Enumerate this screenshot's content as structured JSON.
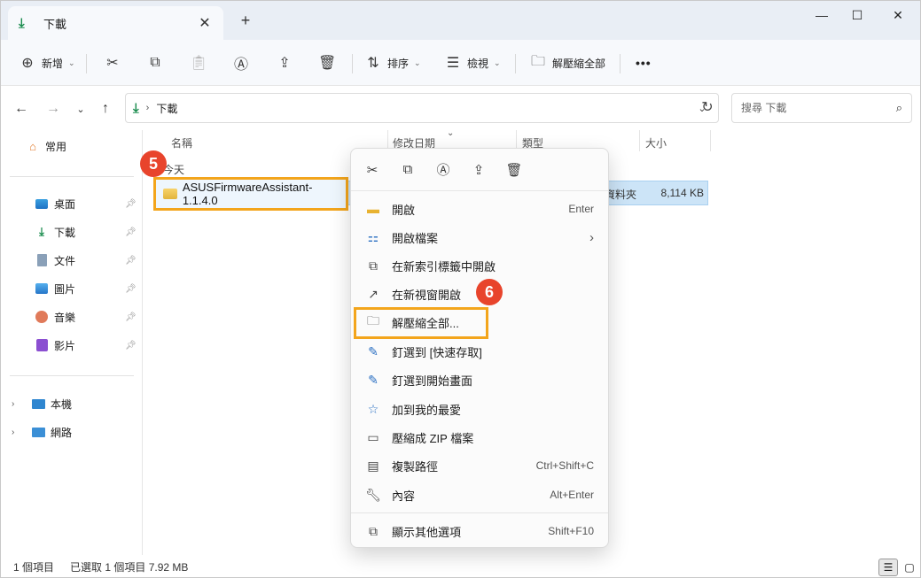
{
  "tab": {
    "title": "下載",
    "close": "✕",
    "new": "+"
  },
  "window_controls": {
    "minimize": "—",
    "maximize": "☐",
    "close": "✕"
  },
  "toolbar": {
    "new_label": "新增",
    "sort_label": "排序",
    "view_label": "檢視",
    "extract_label": "解壓縮全部",
    "more": "•••"
  },
  "address": {
    "path": "下載",
    "refresh": "↻"
  },
  "search": {
    "placeholder": "搜尋 下載"
  },
  "sidebar": {
    "home": "常用",
    "items": [
      {
        "label": "桌面",
        "icon": "desktop-icon"
      },
      {
        "label": "下載",
        "icon": "download-icon"
      },
      {
        "label": "文件",
        "icon": "document-icon"
      },
      {
        "label": "圖片",
        "icon": "pictures-icon"
      },
      {
        "label": "音樂",
        "icon": "music-icon"
      },
      {
        "label": "影片",
        "icon": "video-icon"
      }
    ],
    "this_pc": "本機",
    "network": "網路"
  },
  "columns": {
    "name": "名稱",
    "modified": "修改日期",
    "type": "類型",
    "size": "大小"
  },
  "group": "今天",
  "file": {
    "name": "ASUSFirmwareAssistant-1.1.4.0",
    "type": "檔案資料夾",
    "type_visible": "資料夾",
    "size": "8,114 KB"
  },
  "badges": {
    "step5": "5",
    "step6": "6"
  },
  "context_menu": {
    "items": [
      {
        "label": "開啟",
        "shortcut": "Enter",
        "icon": "folder-icon"
      },
      {
        "label": "開啟檔案",
        "shortcut": "›",
        "icon": "open-with-icon"
      },
      {
        "label": "在新索引標籤中開啟",
        "shortcut": "",
        "icon": "new-tab-icon"
      },
      {
        "label": "在新視窗開啟",
        "shortcut": "",
        "icon": "new-window-icon"
      },
      {
        "label": "解壓縮全部...",
        "shortcut": "",
        "icon": "extract-icon"
      },
      {
        "label": "釘選到 [快速存取]",
        "shortcut": "",
        "icon": "pin-icon"
      },
      {
        "label": "釘選到開始畫面",
        "shortcut": "",
        "icon": "pin-start-icon"
      },
      {
        "label": "加到我的最愛",
        "shortcut": "",
        "icon": "star-icon"
      },
      {
        "label": "壓縮成 ZIP 檔案",
        "shortcut": "",
        "icon": "zip-icon"
      },
      {
        "label": "複製路徑",
        "shortcut": "Ctrl+Shift+C",
        "icon": "copy-path-icon"
      },
      {
        "label": "內容",
        "shortcut": "Alt+Enter",
        "icon": "properties-icon"
      },
      {
        "label": "顯示其他選項",
        "shortcut": "Shift+F10",
        "icon": "more-options-icon"
      }
    ]
  },
  "status": {
    "count": "1 個項目",
    "selected": "已選取 1 個項目 7.92 MB"
  },
  "colors": {
    "accent": "#f3a51c",
    "badge": "#e8442c",
    "selection": "#cce4f7"
  }
}
